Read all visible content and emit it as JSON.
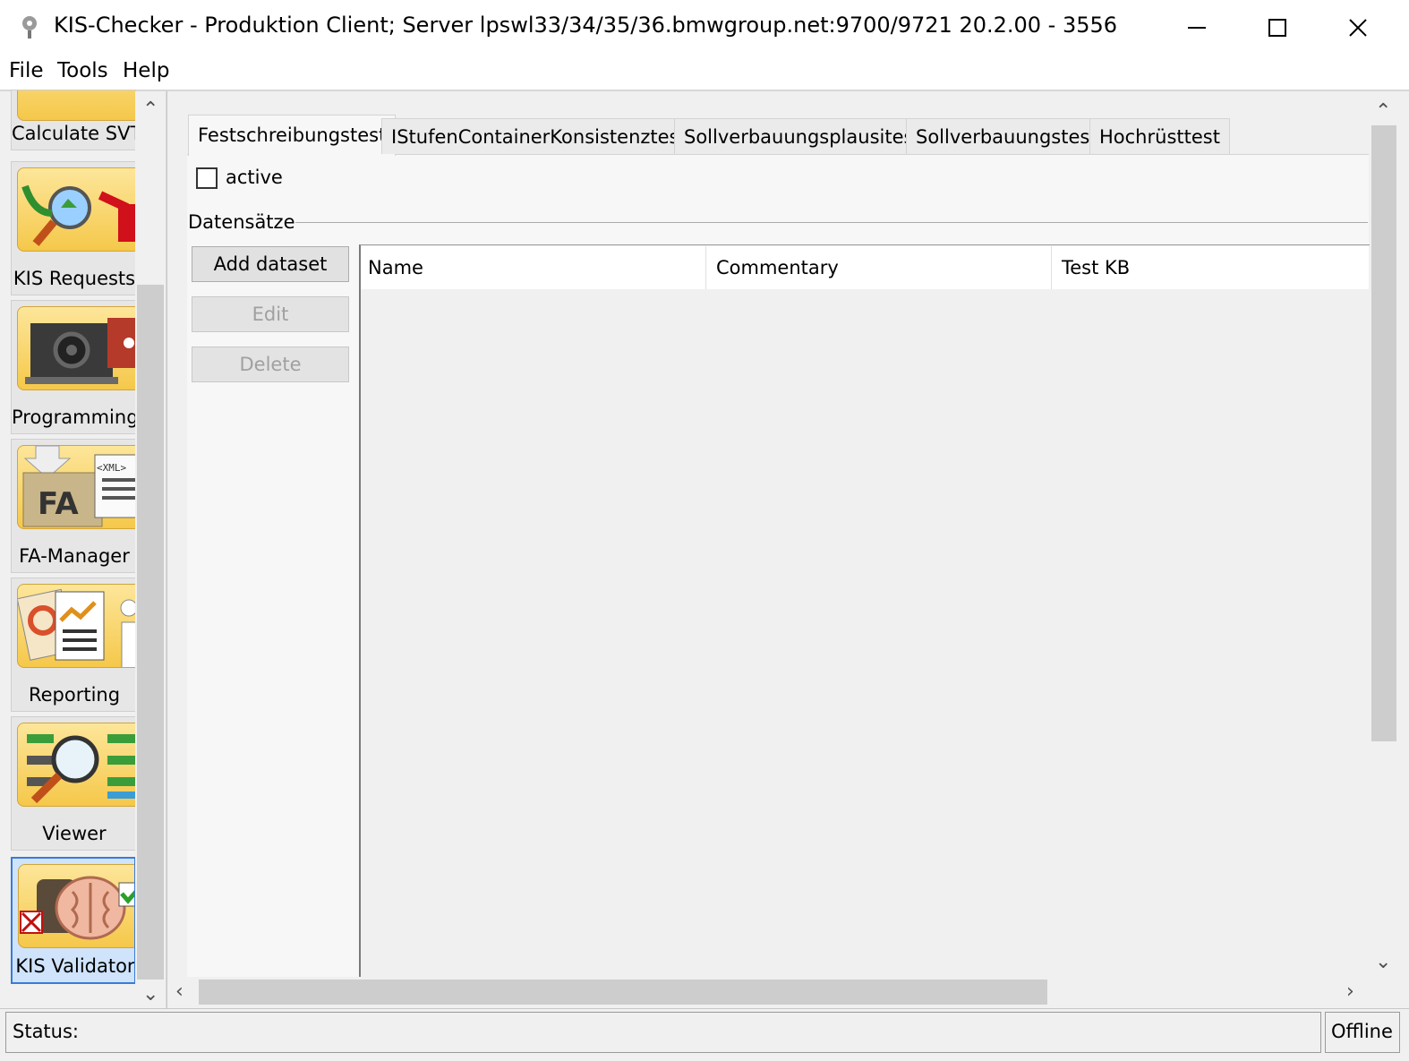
{
  "window": {
    "title": "KIS-Checker - Produktion Client; Server lpswl33/34/35/36.bmwgroup.net:9700/9721 20.2.00 - 3556",
    "minimize_icon": "minimize-icon",
    "maximize_icon": "maximize-icon",
    "close_icon": "close-icon"
  },
  "menu": {
    "items": [
      "File",
      "Tools",
      "Help"
    ]
  },
  "sidebar": {
    "tools": [
      {
        "label": "Calculate SVT",
        "icon": "calculate-svt-icon"
      },
      {
        "label": "KIS Requests",
        "icon": "kis-requests-icon"
      },
      {
        "label": "Programming",
        "icon": "programming-icon"
      },
      {
        "label": "FA-Manager",
        "icon": "fa-manager-icon"
      },
      {
        "label": "Reporting",
        "icon": "reporting-icon"
      },
      {
        "label": "Viewer",
        "icon": "viewer-icon"
      },
      {
        "label": "KIS Validator",
        "icon": "kis-validator-icon",
        "selected": true
      }
    ],
    "fa_text": "FA",
    "xml_text": "<XML>"
  },
  "tabs": [
    "Festschreibungstest",
    "IStufenContainerKonsistenztest",
    "Sollverbauungsplausitest",
    "Sollverbauungstest",
    "Hochrüsttest"
  ],
  "active_tab": "Festschreibungstest",
  "panel": {
    "active_label": "active",
    "active_checked": false,
    "group_label": "Datensätze",
    "buttons": {
      "add": "Add dataset",
      "edit": "Edit",
      "delete": "Delete"
    },
    "table": {
      "columns": [
        "Name",
        "Commentary",
        "Test KB"
      ],
      "rows": []
    }
  },
  "status": {
    "label": "Status:",
    "connection": "Offline"
  },
  "colors": {
    "selected_border": "#3a7bd5",
    "icon_bg": "#f5c84a"
  }
}
